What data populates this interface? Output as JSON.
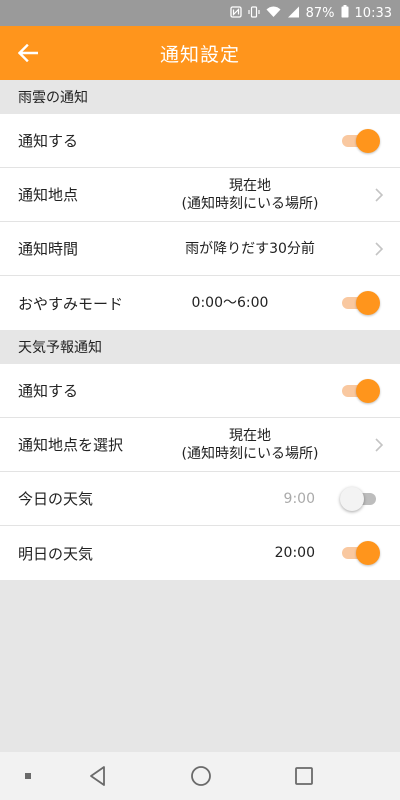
{
  "status_bar": {
    "battery": "87%",
    "time": "10:33",
    "icons": [
      "nfc-icon",
      "vibrate-icon",
      "wifi-icon",
      "signal-icon",
      "battery-icon"
    ]
  },
  "app_bar": {
    "title": "通知設定",
    "back_icon": "arrow-left-icon",
    "color": "#ff951c"
  },
  "sections": [
    {
      "header": "雨雲の通知",
      "rows": [
        {
          "label": "通知する",
          "toggle": true
        },
        {
          "label": "通知地点",
          "value_line1": "現在地",
          "value_line2": "(通知時刻にいる場所)",
          "chevron": true
        },
        {
          "label": "通知時間",
          "value": "雨が降りだす30分前",
          "chevron": true
        },
        {
          "label": "おやすみモード",
          "value": "0:00〜6:00",
          "toggle": true
        }
      ]
    },
    {
      "header": "天気予報通知",
      "rows": [
        {
          "label": "通知する",
          "toggle": true
        },
        {
          "label": "通知地点を選択",
          "value_line1": "現在地",
          "value_line2": "(通知時刻にいる場所)",
          "chevron": true
        },
        {
          "label": "今日の天気",
          "value": "9:00",
          "toggle": false
        },
        {
          "label": "明日の天気",
          "value": "20:00",
          "toggle": true
        }
      ]
    }
  ],
  "nav_bar": {
    "icons": [
      "square-dot-icon",
      "back-triangle-icon",
      "home-circle-icon",
      "recents-square-icon"
    ]
  }
}
